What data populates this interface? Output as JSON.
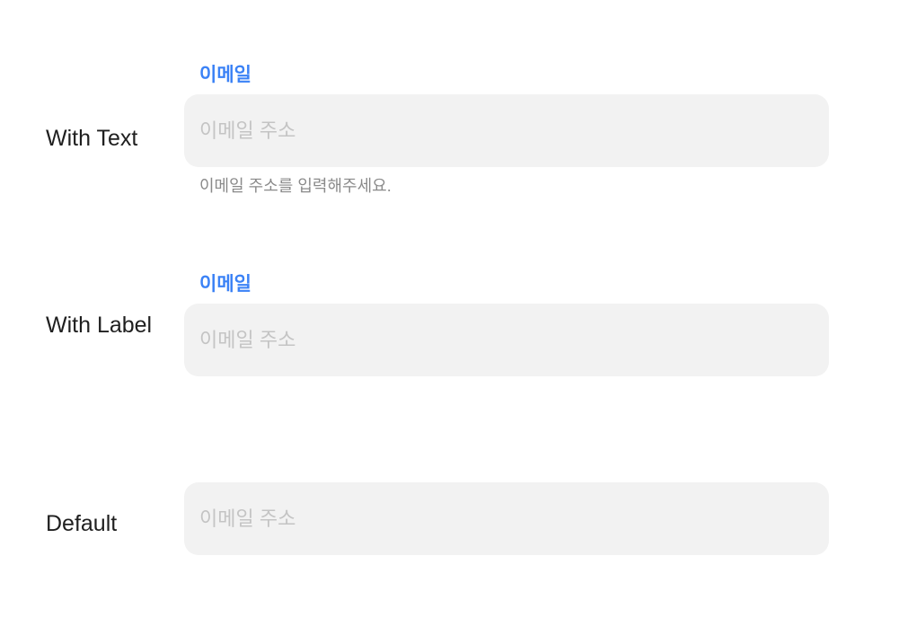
{
  "rows": [
    {
      "row_label": "With Text",
      "field_label": "이메일",
      "placeholder": "이메일 주소",
      "value": "",
      "helper_text": "이메일 주소를 입력해주세요."
    },
    {
      "row_label": "With Label",
      "field_label": "이메일",
      "placeholder": "이메일 주소",
      "value": ""
    },
    {
      "row_label": "Default",
      "placeholder": "이메일 주소",
      "value": ""
    }
  ],
  "colors": {
    "label_accent": "#3b82f6",
    "input_background": "#f2f2f2",
    "placeholder": "#c4c4c4",
    "helper_text": "#8a8a8a",
    "row_label": "#1f1f1f"
  }
}
